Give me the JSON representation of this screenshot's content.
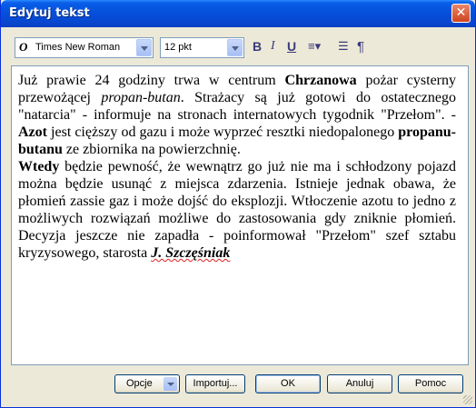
{
  "window": {
    "title": "Edytuj tekst",
    "close_glyph": "✕"
  },
  "toolbar": {
    "font_icon": "O",
    "font_name": "Times New Roman",
    "font_size": "12 pkt",
    "bold_glyph": "B",
    "italic_glyph": "I",
    "underline_glyph": "U",
    "align_glyph": "≡▾",
    "list_glyph": "☰",
    "pilcrow_glyph": "¶"
  },
  "document": {
    "p1": {
      "t1": "Już prawie 24 godziny trwa w centrum ",
      "b1": "Chrzanowa",
      "t2": " pożar cysterny przewożącej ",
      "i1": "propan-butan",
      "t3": ". Strażacy są już gotowi do ostatecznego \"natarcia\" - informuje na stronach internatowych tygodnik \"Przełom\". - ",
      "b2": "Azot",
      "t4": " jest cięższy od gazu i może wyprzeć resztki niedopalonego ",
      "b3": "propanu-butanu",
      "t5": " ze zbiornika na powierzchnię."
    },
    "p2": {
      "b1": "Wtedy",
      "t1": " będzie pewność, że wewnątrz go już nie ma i schłodzony pojazd można będzie usunąć z miejsca zdarzenia. Istnieje jednak obawa, że płomień zassie gaz i może dojść do eksplozji. Wtłoczenie azotu to jedno z możliwych rozwiązań możliwe do zastosowania gdy zniknie płomień. Decyzja jeszcze nie zapadła - poinformował \"Przełom\" szef sztabu kryzysowego, starosta ",
      "bi1": "J. Szczęśniak"
    }
  },
  "buttons": {
    "options": "Opcje",
    "import": "Importuj...",
    "ok": "OK",
    "cancel": "Anuluj",
    "help": "Pomoc"
  }
}
